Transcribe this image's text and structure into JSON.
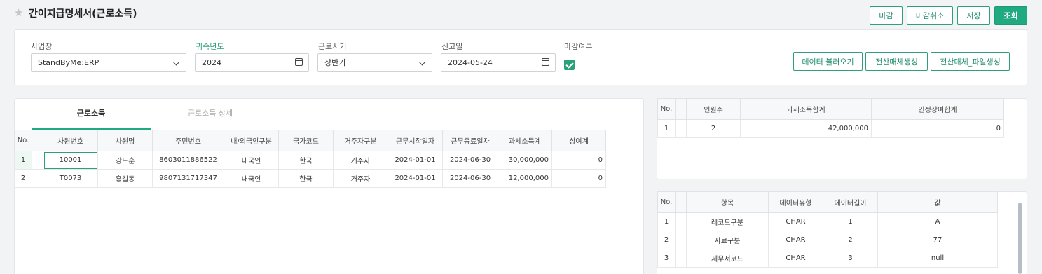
{
  "header": {
    "title": "간이지급명세서(근로소득)",
    "buttons": {
      "close": "마감",
      "close_cancel": "마감취소",
      "save": "저장",
      "search": "조회"
    }
  },
  "filters": {
    "workplace": {
      "label": "사업장",
      "value": "StandByMe:ERP"
    },
    "year": {
      "label": "귀속년도",
      "value": "2024"
    },
    "period": {
      "label": "근로시기",
      "value": "상반기"
    },
    "report_date": {
      "label": "신고일",
      "value": "2024-05-24"
    },
    "closed": {
      "label": "마감여부",
      "checked": true
    }
  },
  "actions": {
    "load_data": "데이터 불러오기",
    "create_media": "전산매체생성",
    "create_media_file": "전산매체_파일생성"
  },
  "tabs": [
    {
      "label": "근로소득",
      "active": true
    },
    {
      "label": "근로소득 상세",
      "active": false
    }
  ],
  "main_table": {
    "headers": [
      "No.",
      "",
      "사원번호",
      "사원명",
      "주민번호",
      "내/외국인구분",
      "국가코드",
      "거주자구분",
      "근무시작일자",
      "근무종료일자",
      "과세소득계",
      "상여계"
    ],
    "rows": [
      [
        "1",
        "",
        "10001",
        "강도훈",
        "8603011886522",
        "내국인",
        "한국",
        "거주자",
        "2024-01-01",
        "2024-06-30",
        "30,000,000",
        "0"
      ],
      [
        "2",
        "",
        "T0073",
        "홍길동",
        "9807131717347",
        "내국인",
        "한국",
        "거주자",
        "2024-01-01",
        "2024-06-30",
        "12,000,000",
        "0"
      ]
    ]
  },
  "summary_table": {
    "headers": [
      "No.",
      "",
      "인원수",
      "과세소득합계",
      "인정상여합계"
    ],
    "rows": [
      [
        "1",
        "",
        "2",
        "42,000,000",
        "0"
      ]
    ]
  },
  "record_table": {
    "headers": [
      "No.",
      "",
      "항목",
      "데이터유형",
      "데이터길이",
      "값"
    ],
    "rows": [
      [
        "1",
        "",
        "레코드구분",
        "CHAR",
        "1",
        "A"
      ],
      [
        "2",
        "",
        "자료구분",
        "CHAR",
        "2",
        "77"
      ],
      [
        "3",
        "",
        "세무서코드",
        "CHAR",
        "3",
        "null"
      ]
    ]
  },
  "colors": {
    "accent": "#1faa82",
    "border": "#2e9e7d"
  },
  "icons": {
    "favorite": "star-icon",
    "dropdown": "chevron-down-icon",
    "date": "calendar-icon",
    "check": "checkbox-checked-icon"
  }
}
